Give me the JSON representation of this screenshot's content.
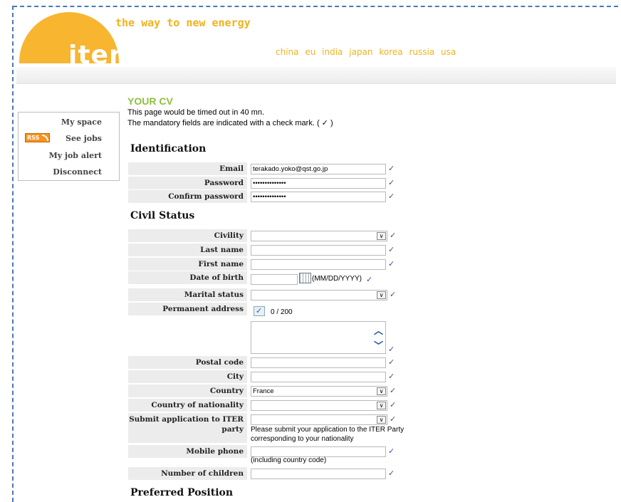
{
  "header": {
    "logo_text": "iter",
    "tagline": "the way to new energy",
    "countries": [
      "china",
      "eu",
      "india",
      "japan",
      "korea",
      "russia",
      "usa"
    ],
    "logo_color": "#f7b530",
    "accent_color": "#f1b21d"
  },
  "sidebar": {
    "items": [
      {
        "label": "My space"
      },
      {
        "label": "See jobs",
        "badge": "RSS"
      },
      {
        "label": "My job alert"
      },
      {
        "label": "Disconnect"
      }
    ]
  },
  "page": {
    "title": "YOUR CV",
    "timeout_text": "This page would be timed out in 40 mn.",
    "mandatory_text": "The mandatory fields are indicated with a check mark. ( ✓ )"
  },
  "check_mark": "✓",
  "identification": {
    "title": "Identification",
    "email": {
      "label": "Email",
      "value": "terakado.yoko@qst.go.jp"
    },
    "password": {
      "label": "Password",
      "value": "••••••••••••••"
    },
    "confirm_password": {
      "label": "Confirm password",
      "value": "••••••••••••••"
    }
  },
  "civil_status": {
    "title": "Civil Status",
    "civility": {
      "label": "Civility",
      "value": ""
    },
    "last_name": {
      "label": "Last name",
      "value": ""
    },
    "first_name": {
      "label": "First name",
      "value": ""
    },
    "date_of_birth": {
      "label": "Date of birth",
      "value": "",
      "format_hint": "(MM/DD/YYYY)"
    },
    "marital_status": {
      "label": "Marital status",
      "value": ""
    },
    "permanent_address": {
      "label": "Permanent address",
      "counter": "0 / 200",
      "value": ""
    },
    "postal_code": {
      "label": "Postal code",
      "value": ""
    },
    "city": {
      "label": "City",
      "value": ""
    },
    "country": {
      "label": "Country",
      "value": "France"
    },
    "country_of_nationality": {
      "label": "Country of nationality",
      "value": ""
    },
    "submit_party": {
      "label_line1": "Submit application to ITER",
      "label_line2": "party",
      "value": "",
      "note_line1": "Please submit your application to the ITER Party",
      "note_line2": "corresponding to your nationality"
    },
    "mobile_phone": {
      "label": "Mobile phone",
      "value": "",
      "note": "(including country code)"
    },
    "number_of_children": {
      "label": "Number of children",
      "value": ""
    }
  },
  "preferred_position": {
    "title": "Preferred Position"
  }
}
